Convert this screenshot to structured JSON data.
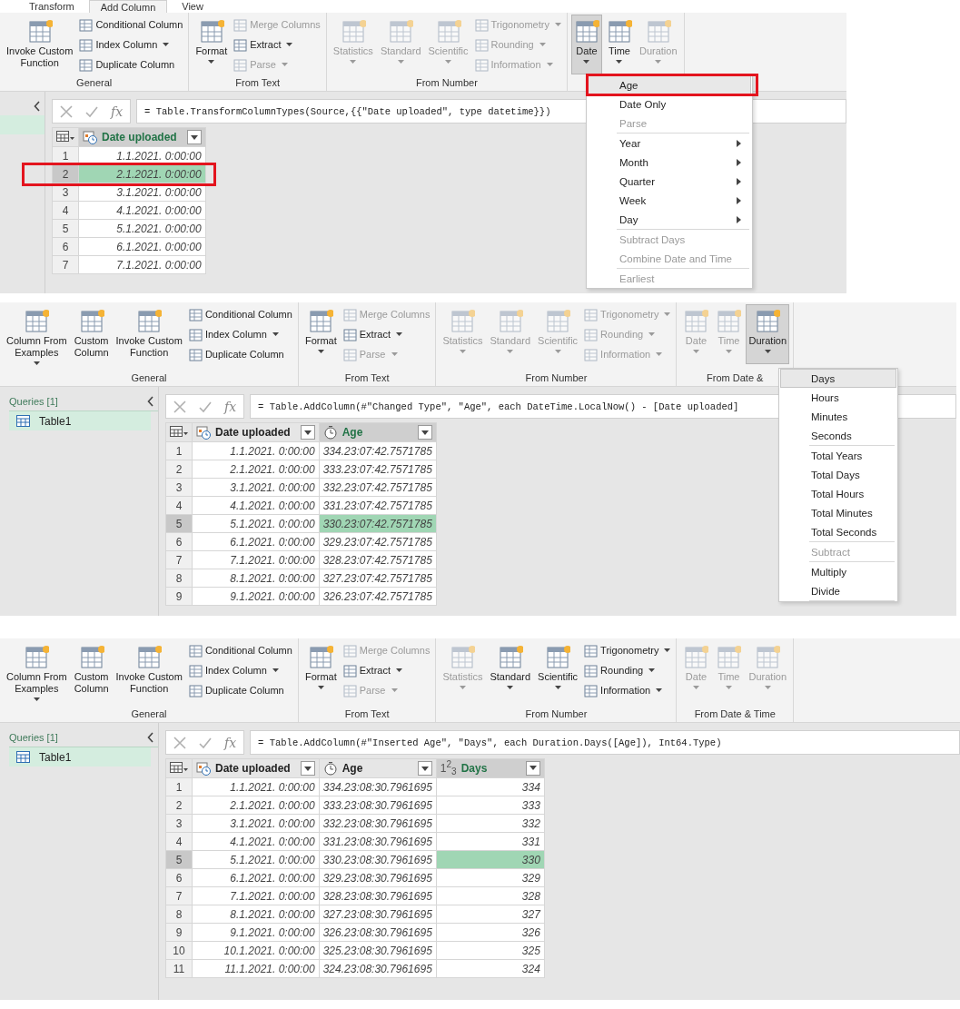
{
  "panels": [
    {
      "tabs": [
        {
          "label": "Transform",
          "selected": false
        },
        {
          "label": "Add Column",
          "selected": true
        },
        {
          "label": "View",
          "selected": false
        }
      ],
      "ribbon": [
        {
          "label": "General",
          "items": [
            {
              "kind": "large",
              "label": "Invoke Custom\nFunction",
              "caret": false,
              "disabled": false,
              "selected": false
            },
            {
              "kind": "stack",
              "items": [
                {
                  "label": "Conditional Column",
                  "caret": false,
                  "disabled": false
                },
                {
                  "label": "Index Column",
                  "caret": true,
                  "disabled": false
                },
                {
                  "label": "Duplicate Column",
                  "caret": false,
                  "disabled": false
                }
              ]
            }
          ]
        },
        {
          "label": "From Text",
          "items": [
            {
              "kind": "large",
              "label": "Format",
              "caret": true,
              "disabled": false,
              "selected": false
            },
            {
              "kind": "stack",
              "items": [
                {
                  "label": "Merge Columns",
                  "caret": false,
                  "disabled": true
                },
                {
                  "label": "Extract",
                  "caret": true,
                  "disabled": false
                },
                {
                  "label": "Parse",
                  "caret": true,
                  "disabled": true
                }
              ]
            }
          ]
        },
        {
          "label": "From Number",
          "items": [
            {
              "kind": "large",
              "label": "Statistics",
              "caret": true,
              "disabled": true,
              "selected": false
            },
            {
              "kind": "large",
              "label": "Standard",
              "caret": true,
              "disabled": true,
              "selected": false
            },
            {
              "kind": "large",
              "label": "Scientific",
              "caret": true,
              "disabled": true,
              "selected": false
            },
            {
              "kind": "stack",
              "items": [
                {
                  "label": "Trigonometry",
                  "caret": true,
                  "disabled": true
                },
                {
                  "label": "Rounding",
                  "caret": true,
                  "disabled": true
                },
                {
                  "label": "Information",
                  "caret": true,
                  "disabled": true
                }
              ]
            }
          ]
        },
        {
          "items": [
            {
              "kind": "large",
              "label": "Date",
              "caret": true,
              "disabled": false,
              "selected": true
            },
            {
              "kind": "large",
              "label": "Time",
              "caret": true,
              "disabled": false,
              "selected": false
            },
            {
              "kind": "large",
              "label": "Duration",
              "caret": true,
              "disabled": true,
              "selected": false
            }
          ]
        }
      ],
      "queries": {
        "items": [
          {
            "selected": true
          }
        ]
      },
      "formula": {
        "fx": "fx",
        "text": "= Table.TransformColumnTypes(Source,{{\"Date uploaded\", type datetime}})"
      },
      "table": {
        "columns": [
          {
            "label": "Date uploaded",
            "kind": "datetime",
            "selected": true
          }
        ],
        "rows": [
          {
            "num": "1",
            "selected": false,
            "annotated": false,
            "cells": [
              {
                "text": "1.1.2021. 0:00:00",
                "selected": false
              }
            ]
          },
          {
            "num": "2",
            "selected": true,
            "annotated": true,
            "cells": [
              {
                "text": "2.1.2021. 0:00:00",
                "selected": true
              }
            ]
          },
          {
            "num": "3",
            "selected": false,
            "annotated": false,
            "cells": [
              {
                "text": "3.1.2021. 0:00:00",
                "selected": false
              }
            ]
          },
          {
            "num": "4",
            "selected": false,
            "annotated": false,
            "cells": [
              {
                "text": "4.1.2021. 0:00:00",
                "selected": false
              }
            ]
          },
          {
            "num": "5",
            "selected": false,
            "annotated": false,
            "cells": [
              {
                "text": "5.1.2021. 0:00:00",
                "selected": false
              }
            ]
          },
          {
            "num": "6",
            "selected": false,
            "annotated": false,
            "cells": [
              {
                "text": "6.1.2021. 0:00:00",
                "selected": false
              }
            ]
          },
          {
            "num": "7",
            "selected": false,
            "annotated": false,
            "cells": [
              {
                "text": "7.1.2021. 0:00:00",
                "selected": false
              }
            ]
          }
        ]
      },
      "menu": {
        "items": [
          {
            "kind": "item",
            "label": "Age",
            "disabled": false,
            "submenu": false,
            "selected": true,
            "annotated": true
          },
          {
            "kind": "item",
            "label": "Date Only",
            "disabled": false,
            "submenu": false,
            "selected": false,
            "annotated": false
          },
          {
            "kind": "item",
            "label": "Parse",
            "disabled": true,
            "submenu": false,
            "selected": false,
            "annotated": false
          },
          {
            "kind": "separator"
          },
          {
            "kind": "item",
            "label": "Year",
            "disabled": false,
            "submenu": true,
            "selected": false,
            "annotated": false
          },
          {
            "kind": "item",
            "label": "Month",
            "disabled": false,
            "submenu": true,
            "selected": false,
            "annotated": false
          },
          {
            "kind": "item",
            "label": "Quarter",
            "disabled": false,
            "submenu": true,
            "selected": false,
            "annotated": false
          },
          {
            "kind": "item",
            "label": "Week",
            "disabled": false,
            "submenu": true,
            "selected": false,
            "annotated": false
          },
          {
            "kind": "item",
            "label": "Day",
            "disabled": false,
            "submenu": true,
            "selected": false,
            "annotated": false
          },
          {
            "kind": "separator"
          },
          {
            "kind": "item",
            "label": "Subtract Days",
            "disabled": true,
            "submenu": false,
            "selected": false,
            "annotated": false
          },
          {
            "kind": "item",
            "label": "Combine Date and Time",
            "disabled": true,
            "submenu": false,
            "selected": false,
            "annotated": false
          },
          {
            "kind": "separator"
          },
          {
            "kind": "item",
            "label": "Earliest",
            "disabled": true,
            "submenu": false,
            "selected": false,
            "annotated": false
          }
        ]
      }
    },
    {
      "ribbon": [
        {
          "label": "General",
          "items": [
            {
              "kind": "large",
              "label": "Column From\nExamples",
              "caret": true,
              "disabled": false,
              "selected": false
            },
            {
              "kind": "large",
              "label": "Custom\nColumn",
              "caret": false,
              "disabled": false,
              "selected": false
            },
            {
              "kind": "large",
              "label": "Invoke Custom\nFunction",
              "caret": false,
              "disabled": false,
              "selected": false
            },
            {
              "kind": "stack",
              "items": [
                {
                  "label": "Conditional Column",
                  "caret": false,
                  "disabled": false
                },
                {
                  "label": "Index Column",
                  "caret": true,
                  "disabled": false
                },
                {
                  "label": "Duplicate Column",
                  "caret": false,
                  "disabled": false
                }
              ]
            }
          ]
        },
        {
          "label": "From Text",
          "items": [
            {
              "kind": "large",
              "label": "Format",
              "caret": true,
              "disabled": false,
              "selected": false
            },
            {
              "kind": "stack",
              "items": [
                {
                  "label": "Merge Columns",
                  "caret": false,
                  "disabled": true
                },
                {
                  "label": "Extract",
                  "caret": true,
                  "disabled": false
                },
                {
                  "label": "Parse",
                  "caret": true,
                  "disabled": true
                }
              ]
            }
          ]
        },
        {
          "label": "From Number",
          "items": [
            {
              "kind": "large",
              "label": "Statistics",
              "caret": true,
              "disabled": true,
              "selected": false
            },
            {
              "kind": "large",
              "label": "Standard",
              "caret": true,
              "disabled": true,
              "selected": false
            },
            {
              "kind": "large",
              "label": "Scientific",
              "caret": true,
              "disabled": true,
              "selected": false
            },
            {
              "kind": "stack",
              "items": [
                {
                  "label": "Trigonometry",
                  "caret": true,
                  "disabled": true
                },
                {
                  "label": "Rounding",
                  "caret": true,
                  "disabled": true
                },
                {
                  "label": "Information",
                  "caret": true,
                  "disabled": true
                }
              ]
            }
          ]
        },
        {
          "label": "From Date &",
          "items": [
            {
              "kind": "large",
              "label": "Date",
              "caret": true,
              "disabled": true,
              "selected": false
            },
            {
              "kind": "large",
              "label": "Time",
              "caret": true,
              "disabled": true,
              "selected": false
            },
            {
              "kind": "large",
              "label": "Duration",
              "caret": true,
              "disabled": false,
              "selected": true
            }
          ]
        }
      ],
      "queries": {
        "header": "Queries [1]",
        "items": [
          {
            "label": "Table1",
            "selected": true
          }
        ]
      },
      "formula": {
        "fx": "fx",
        "text": "= Table.AddColumn(#\"Changed Type\", \"Age\", each DateTime.LocalNow() - [Date uploaded]"
      },
      "table": {
        "columns": [
          {
            "label": "Date uploaded",
            "kind": "datetime",
            "selected": false
          },
          {
            "label": "Age",
            "kind": "duration",
            "selected": true
          }
        ],
        "rows": [
          {
            "num": "1",
            "selected": false,
            "cells": [
              {
                "text": "1.1.2021. 0:00:00",
                "selected": false
              },
              {
                "text": "334.23:07:42.7571785",
                "selected": false
              }
            ]
          },
          {
            "num": "2",
            "selected": false,
            "cells": [
              {
                "text": "2.1.2021. 0:00:00",
                "selected": false
              },
              {
                "text": "333.23:07:42.7571785",
                "selected": false
              }
            ]
          },
          {
            "num": "3",
            "selected": false,
            "cells": [
              {
                "text": "3.1.2021. 0:00:00",
                "selected": false
              },
              {
                "text": "332.23:07:42.7571785",
                "selected": false
              }
            ]
          },
          {
            "num": "4",
            "selected": false,
            "cells": [
              {
                "text": "4.1.2021. 0:00:00",
                "selected": false
              },
              {
                "text": "331.23:07:42.7571785",
                "selected": false
              }
            ]
          },
          {
            "num": "5",
            "selected": true,
            "cells": [
              {
                "text": "5.1.2021. 0:00:00",
                "selected": false
              },
              {
                "text": "330.23:07:42.7571785",
                "selected": true
              }
            ]
          },
          {
            "num": "6",
            "selected": false,
            "cells": [
              {
                "text": "6.1.2021. 0:00:00",
                "selected": false
              },
              {
                "text": "329.23:07:42.7571785",
                "selected": false
              }
            ]
          },
          {
            "num": "7",
            "selected": false,
            "cells": [
              {
                "text": "7.1.2021. 0:00:00",
                "selected": false
              },
              {
                "text": "328.23:07:42.7571785",
                "selected": false
              }
            ]
          },
          {
            "num": "8",
            "selected": false,
            "cells": [
              {
                "text": "8.1.2021. 0:00:00",
                "selected": false
              },
              {
                "text": "327.23:07:42.7571785",
                "selected": false
              }
            ]
          },
          {
            "num": "9",
            "selected": false,
            "cells": [
              {
                "text": "9.1.2021. 0:00:00",
                "selected": false
              },
              {
                "text": "326.23:07:42.7571785",
                "selected": false
              }
            ]
          }
        ]
      },
      "menu": {
        "items": [
          {
            "kind": "item",
            "label": "Days",
            "disabled": false,
            "submenu": false,
            "selected": true,
            "annotated": false
          },
          {
            "kind": "item",
            "label": "Hours",
            "disabled": false,
            "submenu": false,
            "selected": false,
            "annotated": false
          },
          {
            "kind": "item",
            "label": "Minutes",
            "disabled": false,
            "submenu": false,
            "selected": false,
            "annotated": false
          },
          {
            "kind": "item",
            "label": "Seconds",
            "disabled": false,
            "submenu": false,
            "selected": false,
            "annotated": false
          },
          {
            "kind": "separator"
          },
          {
            "kind": "item",
            "label": "Total Years",
            "disabled": false,
            "submenu": false,
            "selected": false,
            "annotated": false
          },
          {
            "kind": "item",
            "label": "Total Days",
            "disabled": false,
            "submenu": false,
            "selected": false,
            "annotated": false
          },
          {
            "kind": "item",
            "label": "Total Hours",
            "disabled": false,
            "submenu": false,
            "selected": false,
            "annotated": false
          },
          {
            "kind": "item",
            "label": "Total Minutes",
            "disabled": false,
            "submenu": false,
            "selected": false,
            "annotated": false
          },
          {
            "kind": "item",
            "label": "Total Seconds",
            "disabled": false,
            "submenu": false,
            "selected": false,
            "annotated": false
          },
          {
            "kind": "separator"
          },
          {
            "kind": "item",
            "label": "Subtract",
            "disabled": true,
            "submenu": false,
            "selected": false,
            "annotated": false
          },
          {
            "kind": "separator"
          },
          {
            "kind": "item",
            "label": "Multiply",
            "disabled": false,
            "submenu": false,
            "selected": false,
            "annotated": false
          },
          {
            "kind": "item",
            "label": "Divide",
            "disabled": false,
            "submenu": false,
            "selected": false,
            "annotated": false
          },
          {
            "kind": "separator"
          }
        ]
      }
    },
    {
      "ribbon": [
        {
          "label": "General",
          "items": [
            {
              "kind": "large",
              "label": "Column From\nExamples",
              "caret": true,
              "disabled": false,
              "selected": false
            },
            {
              "kind": "large",
              "label": "Custom\nColumn",
              "caret": false,
              "disabled": false,
              "selected": false
            },
            {
              "kind": "large",
              "label": "Invoke Custom\nFunction",
              "caret": false,
              "disabled": false,
              "selected": false
            },
            {
              "kind": "stack",
              "items": [
                {
                  "label": "Conditional Column",
                  "caret": false,
                  "disabled": false
                },
                {
                  "label": "Index Column",
                  "caret": true,
                  "disabled": false
                },
                {
                  "label": "Duplicate Column",
                  "caret": false,
                  "disabled": false
                }
              ]
            }
          ]
        },
        {
          "label": "From Text",
          "items": [
            {
              "kind": "large",
              "label": "Format",
              "caret": true,
              "disabled": false,
              "selected": false
            },
            {
              "kind": "stack",
              "items": [
                {
                  "label": "Merge Columns",
                  "caret": false,
                  "disabled": true
                },
                {
                  "label": "Extract",
                  "caret": true,
                  "disabled": false
                },
                {
                  "label": "Parse",
                  "caret": true,
                  "disabled": true
                }
              ]
            }
          ]
        },
        {
          "label": "From Number",
          "items": [
            {
              "kind": "large",
              "label": "Statistics",
              "caret": true,
              "disabled": true,
              "selected": false
            },
            {
              "kind": "large",
              "label": "Standard",
              "caret": true,
              "disabled": false,
              "selected": false
            },
            {
              "kind": "large",
              "label": "Scientific",
              "caret": true,
              "disabled": false,
              "selected": false
            },
            {
              "kind": "stack",
              "items": [
                {
                  "label": "Trigonometry",
                  "caret": true,
                  "disabled": false
                },
                {
                  "label": "Rounding",
                  "caret": true,
                  "disabled": false
                },
                {
                  "label": "Information",
                  "caret": true,
                  "disabled": false
                }
              ]
            }
          ]
        },
        {
          "label": "From Date & Time",
          "items": [
            {
              "kind": "large",
              "label": "Date",
              "caret": true,
              "disabled": true,
              "selected": false
            },
            {
              "kind": "large",
              "label": "Time",
              "caret": true,
              "disabled": true,
              "selected": false
            },
            {
              "kind": "large",
              "label": "Duration",
              "caret": true,
              "disabled": true,
              "selected": false
            }
          ]
        }
      ],
      "queries": {
        "header": "Queries [1]",
        "items": [
          {
            "label": "Table1",
            "selected": true
          }
        ]
      },
      "formula": {
        "fx": "fx",
        "text": "= Table.AddColumn(#\"Inserted Age\", \"Days\", each Duration.Days([Age]), Int64.Type)"
      },
      "table": {
        "columns": [
          {
            "label": "Date uploaded",
            "kind": "datetime",
            "selected": false
          },
          {
            "label": "Age",
            "kind": "duration",
            "selected": false
          },
          {
            "label": "Days",
            "kind": "integer",
            "type_glyph": "1$^{2}$$_{3}$",
            "selected": true
          }
        ],
        "rows": [
          {
            "num": "1",
            "selected": false,
            "cells": [
              {
                "text": "1.1.2021. 0:00:00",
                "selected": false
              },
              {
                "text": "334.23:08:30.7961695",
                "selected": false
              },
              {
                "text": "334",
                "selected": false
              }
            ]
          },
          {
            "num": "2",
            "selected": false,
            "cells": [
              {
                "text": "2.1.2021. 0:00:00",
                "selected": false
              },
              {
                "text": "333.23:08:30.7961695",
                "selected": false
              },
              {
                "text": "333",
                "selected": false
              }
            ]
          },
          {
            "num": "3",
            "selected": false,
            "cells": [
              {
                "text": "3.1.2021. 0:00:00",
                "selected": false
              },
              {
                "text": "332.23:08:30.7961695",
                "selected": false
              },
              {
                "text": "332",
                "selected": false
              }
            ]
          },
          {
            "num": "4",
            "selected": false,
            "cells": [
              {
                "text": "4.1.2021. 0:00:00",
                "selected": false
              },
              {
                "text": "331.23:08:30.7961695",
                "selected": false
              },
              {
                "text": "331",
                "selected": false
              }
            ]
          },
          {
            "num": "5",
            "selected": true,
            "cells": [
              {
                "text": "5.1.2021. 0:00:00",
                "selected": false
              },
              {
                "text": "330.23:08:30.7961695",
                "selected": false
              },
              {
                "text": "330",
                "selected": true
              }
            ]
          },
          {
            "num": "6",
            "selected": false,
            "cells": [
              {
                "text": "6.1.2021. 0:00:00",
                "selected": false
              },
              {
                "text": "329.23:08:30.7961695",
                "selected": false
              },
              {
                "text": "329",
                "selected": false
              }
            ]
          },
          {
            "num": "7",
            "selected": false,
            "cells": [
              {
                "text": "7.1.2021. 0:00:00",
                "selected": false
              },
              {
                "text": "328.23:08:30.7961695",
                "selected": false
              },
              {
                "text": "328",
                "selected": false
              }
            ]
          },
          {
            "num": "8",
            "selected": false,
            "cells": [
              {
                "text": "8.1.2021. 0:00:00",
                "selected": false
              },
              {
                "text": "327.23:08:30.7961695",
                "selected": false
              },
              {
                "text": "327",
                "selected": false
              }
            ]
          },
          {
            "num": "9",
            "selected": false,
            "cells": [
              {
                "text": "9.1.2021. 0:00:00",
                "selected": false
              },
              {
                "text": "326.23:08:30.7961695",
                "selected": false
              },
              {
                "text": "326",
                "selected": false
              }
            ]
          },
          {
            "num": "10",
            "selected": false,
            "cells": [
              {
                "text": "10.1.2021. 0:00:00",
                "selected": false
              },
              {
                "text": "325.23:08:30.7961695",
                "selected": false
              },
              {
                "text": "325",
                "selected": false
              }
            ]
          },
          {
            "num": "11",
            "selected": false,
            "cells": [
              {
                "text": "11.1.2021. 0:00:00",
                "selected": false
              },
              {
                "text": "324.23:08:30.7961695",
                "selected": false
              },
              {
                "text": "324",
                "selected": false
              }
            ]
          }
        ]
      }
    }
  ]
}
